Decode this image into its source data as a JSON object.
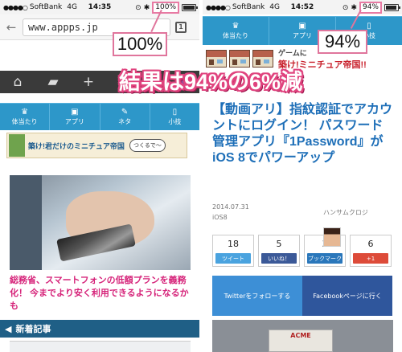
{
  "left": {
    "status": {
      "signal": "●●●●○",
      "carrier": "SoftBank",
      "network": "4G",
      "time": "14:35",
      "battery": "100%"
    },
    "url": "www.appps.jp",
    "callout": "100%",
    "nav": [
      {
        "icon": "trophy-icon",
        "glyph": "♛",
        "label": "体当たり"
      },
      {
        "icon": "app-icon",
        "glyph": "▣",
        "label": "アプリ"
      },
      {
        "icon": "bubble-icon",
        "glyph": "✎",
        "label": "ネタ"
      },
      {
        "icon": "phone-icon",
        "glyph": "▯",
        "label": "小技"
      }
    ],
    "banner_text": "築け!君だけのミニチュア帝国",
    "banner_badge": "つくるで～",
    "article_text": "総務省、スマートフォンの低額プランを義務化！ 今までより安く利用できるようになるかも",
    "section_label": "新着記事",
    "battery_level": 1.0
  },
  "right": {
    "status": {
      "signal": "●●●●○",
      "carrier": "SoftBank",
      "network": "4G",
      "time": "14:52",
      "battery": "94%"
    },
    "callout": "94%",
    "nav": [
      {
        "icon": "trophy-icon",
        "glyph": "♛",
        "label": "体当たり"
      },
      {
        "icon": "app-icon",
        "glyph": "▣",
        "label": "アプリ"
      },
      {
        "icon": "phone-icon",
        "glyph": "▯",
        "label": "小技"
      }
    ],
    "banner_top": "ゲームに",
    "banner_text": "築け!ミニチュア帝国!!",
    "article_title": "【動画アリ】指紋認証でアカウントにログイン！ パスワード管理アプリ『1Password』がiOS 8でパワーアップ",
    "date": "2014.07.31",
    "category": "iOS8",
    "author": "ハンサムクロジ",
    "shares": [
      {
        "count": "18",
        "label": "ツイート",
        "color": "#4aa3df"
      },
      {
        "count": "5",
        "label": "いいね！",
        "color": "#3b5998"
      },
      {
        "count": "3",
        "label": "ブックマーク",
        "color": "#2a77bb"
      },
      {
        "count": "6",
        "label": "+1",
        "color": "#dd4b39"
      }
    ],
    "follow_twitter": "Twitterをフォローする",
    "follow_facebook": "Facebookページに行く",
    "bottom_label": "ACME",
    "battery_level": 0.94
  },
  "headline": "結果は94%の6%減",
  "colors": {
    "accent": "#e0437e",
    "nav": "#2d97c9",
    "link": "#1e6fb8",
    "pink_text": "#d6247a"
  }
}
